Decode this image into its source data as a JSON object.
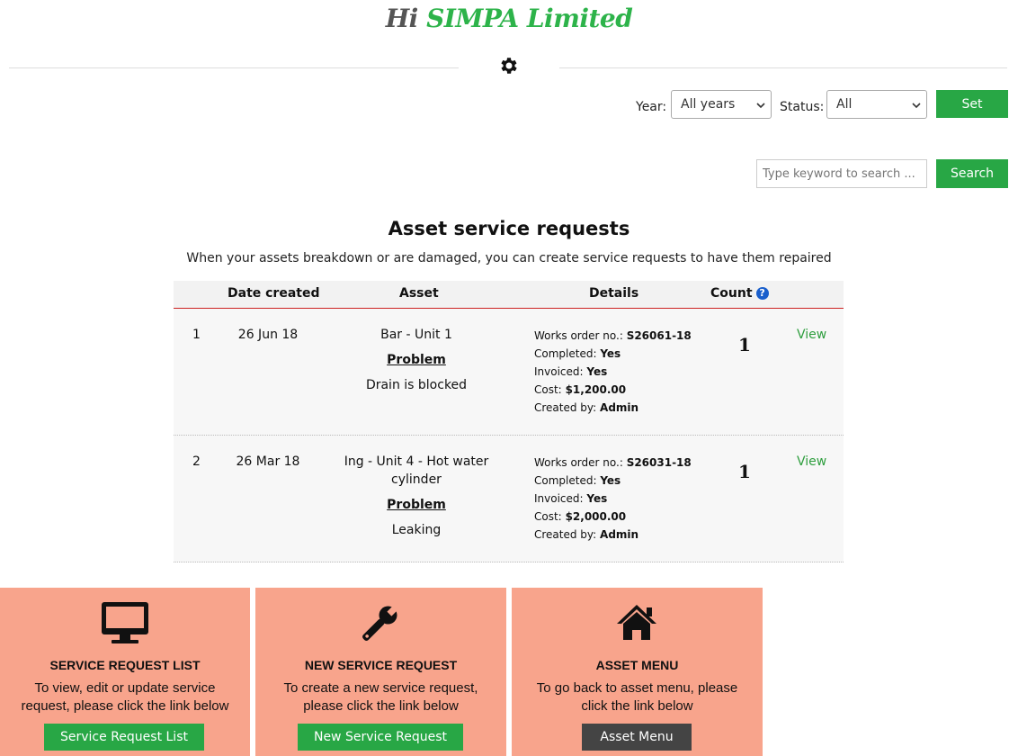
{
  "brand": {
    "hi": "Hi",
    "company": "SIMPA Limited"
  },
  "filters": {
    "year_label": "Year:",
    "year_value": "All years",
    "status_label": "Status:",
    "status_value": "All",
    "set_label": "Set"
  },
  "search": {
    "placeholder": "Type keyword to search ...",
    "button_label": "Search"
  },
  "page": {
    "title": "Asset service requests",
    "subtitle": "When your assets breakdown or are damaged, you can create service requests to have them repaired"
  },
  "table": {
    "headers": {
      "date": "Date created",
      "asset": "Asset",
      "details": "Details",
      "count": "Count",
      "help": "?"
    },
    "detail_labels": {
      "works_order": "Works order no.:",
      "completed": "Completed:",
      "invoiced": "Invoiced:",
      "cost": "Cost:",
      "created_by": "Created by:"
    },
    "problem_label": "Problem",
    "view_label": "View",
    "rows": [
      {
        "num": "1",
        "date": "26 Jun 18",
        "asset": "Bar - Unit 1",
        "problem": "Drain is blocked",
        "works_order": "S26061-18",
        "completed": "Yes",
        "invoiced": "Yes",
        "cost": "$1,200.00",
        "created_by": "Admin",
        "count": "1"
      },
      {
        "num": "2",
        "date": "26 Mar 18",
        "asset": "Ing - Unit 4 - Hot water cylinder",
        "problem": "Leaking",
        "works_order": "S26031-18",
        "completed": "Yes",
        "invoiced": "Yes",
        "cost": "$2,000.00",
        "created_by": "Admin",
        "count": "1"
      }
    ]
  },
  "cards": [
    {
      "title": "SERVICE REQUEST LIST",
      "desc": "To view, edit or update service request, please click the link below",
      "button": "Service Request List",
      "icon": "monitor-icon"
    },
    {
      "title": "NEW SERVICE REQUEST",
      "desc": "To create a new service request, please click the link below",
      "button": "New Service Request",
      "icon": "wrench-icon"
    },
    {
      "title": "ASSET MENU",
      "desc": "To go back to asset menu, please click the link below",
      "button": "Asset Menu",
      "icon": "home-icon"
    }
  ],
  "colors": {
    "green": "#28a745",
    "card_bg": "#f8a48c",
    "dark_button": "#444444",
    "header_rule": "#cc2222"
  }
}
